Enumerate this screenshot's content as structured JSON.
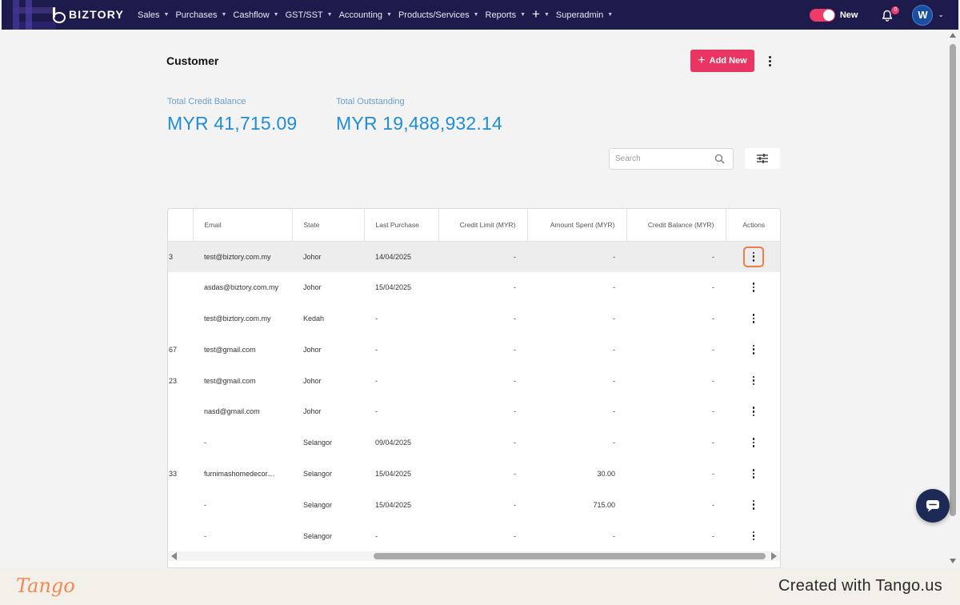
{
  "nav": {
    "brand": "BIZTORY",
    "menu": [
      {
        "label": "Sales"
      },
      {
        "label": "Purchases"
      },
      {
        "label": "Cashflow"
      },
      {
        "label": "GST/SST"
      },
      {
        "label": "Accounting"
      },
      {
        "label": "Products/Services"
      },
      {
        "label": "Reports"
      },
      {
        "label": "+"
      },
      {
        "label": "Superadmin"
      }
    ],
    "toggle_label": "New",
    "notification_count": "0",
    "avatar_initial": "W"
  },
  "page": {
    "title": "Customer",
    "add_button": "Add New",
    "stats": [
      {
        "label": "Total Credit Balance",
        "value": "MYR 41,715.09"
      },
      {
        "label": "Total Outstanding",
        "value": "MYR 19,488,932.14"
      }
    ],
    "search_placeholder": "Search"
  },
  "table": {
    "columns": [
      "",
      "Email",
      "State",
      "Last Purchase",
      "Credit Limit (MYR)",
      "Amount Spent (MYR)",
      "Credit Balance (MYR)",
      "Actions"
    ],
    "rows": [
      {
        "c0": "3",
        "email": "test@biztory.com.my",
        "state": "Johor",
        "last": "14/04/2025",
        "limit": "-",
        "spent": "-",
        "balance": "-"
      },
      {
        "c0": "",
        "email": "asdas@biztory.com.my",
        "state": "Johor",
        "last": "15/04/2025",
        "limit": "-",
        "spent": "-",
        "balance": "-"
      },
      {
        "c0": "",
        "email": "test@biztory.com.my",
        "state": "Kedah",
        "last": "-",
        "limit": "-",
        "spent": "-",
        "balance": "-"
      },
      {
        "c0": "67",
        "email": "test@gmail.com",
        "state": "Johor",
        "last": "-",
        "limit": "-",
        "spent": "-",
        "balance": "-"
      },
      {
        "c0": "23",
        "email": "test@gmail.com",
        "state": "Johor",
        "last": "-",
        "limit": "-",
        "spent": "-",
        "balance": "-"
      },
      {
        "c0": "",
        "email": "nasd@gmail.com",
        "state": "Johor",
        "last": "-",
        "limit": "-",
        "spent": "-",
        "balance": "-"
      },
      {
        "c0": "",
        "email": "-",
        "state": "Selangor",
        "last": "09/04/2025",
        "limit": "-",
        "spent": "-",
        "balance": "-"
      },
      {
        "c0": "33",
        "email": "furnimashomedecor@...",
        "state": "Selangor",
        "last": "15/04/2025",
        "limit": "-",
        "spent": "30.00",
        "balance": "-"
      },
      {
        "c0": "",
        "email": "-",
        "state": "Selangor",
        "last": "15/04/2025",
        "limit": "-",
        "spent": "715.00",
        "balance": "-"
      },
      {
        "c0": "",
        "email": "-",
        "state": "Selangor",
        "last": "-",
        "limit": "-",
        "spent": "-",
        "balance": "-"
      }
    ]
  },
  "footer": {
    "logo": "Tango",
    "credit": "Created with Tango.us"
  },
  "colors": {
    "nav_bg": "#1d1b4b",
    "accent": "#ea3461",
    "stat_blue": "#1f8ed6",
    "focus_ring": "#ef7d4a"
  }
}
